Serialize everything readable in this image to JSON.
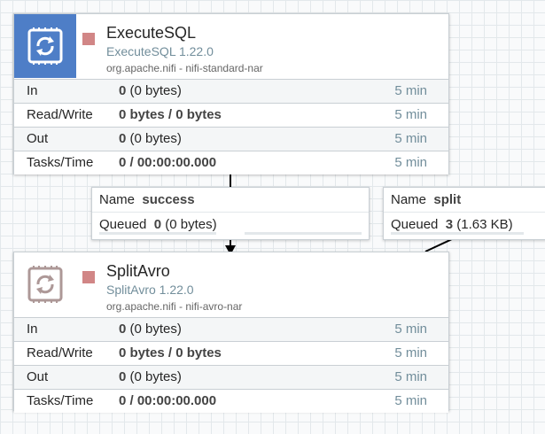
{
  "processors": [
    {
      "name": "ExecuteSQL",
      "type": "ExecuteSQL 1.22.0",
      "bundle": "org.apache.nifi - nifi-standard-nar",
      "stats": {
        "in": {
          "label": "In",
          "count": "0",
          "detail": " (0 bytes)",
          "time": "5 min"
        },
        "read_write": {
          "label": "Read/Write",
          "value": "0 bytes / 0 bytes",
          "time": "5 min"
        },
        "out": {
          "label": "Out",
          "count": "0",
          "detail": " (0 bytes)",
          "time": "5 min"
        },
        "tasks_time": {
          "label": "Tasks/Time",
          "value": "0 / 00:00:00.000",
          "time": "5 min"
        }
      }
    },
    {
      "name": "SplitAvro",
      "type": "SplitAvro 1.22.0",
      "bundle": "org.apache.nifi - nifi-avro-nar",
      "stats": {
        "in": {
          "label": "In",
          "count": "0",
          "detail": " (0 bytes)",
          "time": "5 min"
        },
        "read_write": {
          "label": "Read/Write",
          "value": "0 bytes / 0 bytes",
          "time": "5 min"
        },
        "out": {
          "label": "Out",
          "count": "0",
          "detail": " (0 bytes)",
          "time": "5 min"
        },
        "tasks_time": {
          "label": "Tasks/Time",
          "value": "0 / 00:00:00.000",
          "time": "5 min"
        }
      }
    }
  ],
  "connections": [
    {
      "name_label": "Name",
      "name": "success",
      "queued_label": "Queued",
      "queued_count": "0",
      "queued_detail": " (0 bytes)"
    },
    {
      "name_label": "Name",
      "name": "split",
      "queued_label": "Queued",
      "queued_count": "3",
      "queued_detail": " (1.63 KB)"
    }
  ],
  "colors": {
    "icon_bg_execute": "#4e7ec7",
    "run_status_stopped": "#d18686",
    "type_text": "#728e9b"
  },
  "icons": {
    "processor": "processor-icon",
    "run_status": "stopped-status-icon"
  }
}
